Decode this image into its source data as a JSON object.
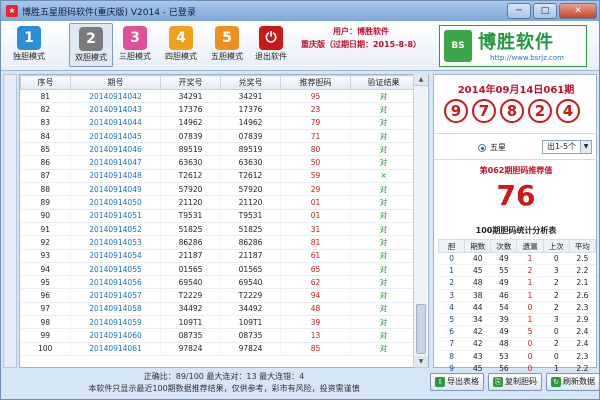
{
  "window": {
    "title": "博胜五星胆码软件(重庆版) V2014 - 已登录",
    "minimize": "─",
    "maximize": "□",
    "close": "✕"
  },
  "toolbar": [
    {
      "num": "1",
      "label": "独胆模式",
      "color": "#2b8fd8"
    },
    {
      "num": "2",
      "label": "双胆模式",
      "color": "#7a7a7a"
    },
    {
      "num": "3",
      "label": "三胆模式",
      "color": "#e0509a"
    },
    {
      "num": "4",
      "label": "四胆模式",
      "color": "#f0a020"
    },
    {
      "num": "5",
      "label": "五胆模式",
      "color": "#f09020"
    },
    {
      "num": "⏻",
      "label": "退出软件",
      "color": "#c81818"
    }
  ],
  "user": {
    "line1": "用户：博胜软件",
    "line2": "重庆版（过期日期：2015-8-8）"
  },
  "logo": {
    "mark": "BS",
    "name": "博胜软件",
    "url": "http://www.bsrjz.com"
  },
  "grid": {
    "headers": [
      "序号",
      "期号",
      "开奖号",
      "兑奖号",
      "推荐胆码",
      "验证结果"
    ],
    "rows": [
      [
        "81",
        "20140914042",
        "34291",
        "34291",
        "95",
        "对"
      ],
      [
        "82",
        "20140914043",
        "17376",
        "17376",
        "23",
        "对"
      ],
      [
        "83",
        "20140914044",
        "14962",
        "14962",
        "79",
        "对"
      ],
      [
        "84",
        "20140914045",
        "07839",
        "07839",
        "71",
        "对"
      ],
      [
        "85",
        "20140914046",
        "89519",
        "89519",
        "80",
        "对"
      ],
      [
        "86",
        "20140914047",
        "63630",
        "63630",
        "50",
        "对"
      ],
      [
        "87",
        "20140914048",
        "T2612",
        "T2612",
        "59",
        "×"
      ],
      [
        "88",
        "20140914049",
        "57920",
        "57920",
        "29",
        "对"
      ],
      [
        "89",
        "20140914050",
        "21120",
        "21120",
        "01",
        "对"
      ],
      [
        "90",
        "20140914051",
        "T9531",
        "T9531",
        "01",
        "对"
      ],
      [
        "91",
        "20140914052",
        "51825",
        "51825",
        "31",
        "对"
      ],
      [
        "92",
        "20140914053",
        "86286",
        "86286",
        "81",
        "对"
      ],
      [
        "93",
        "20140914054",
        "21187",
        "21187",
        "61",
        "对"
      ],
      [
        "94",
        "20140914055",
        "01565",
        "01565",
        "65",
        "对"
      ],
      [
        "95",
        "20140914056",
        "69540",
        "69540",
        "62",
        "对"
      ],
      [
        "96",
        "20140914057",
        "T2229",
        "T2229",
        "94",
        "对"
      ],
      [
        "97",
        "20140914058",
        "34492",
        "34492",
        "48",
        "对"
      ],
      [
        "98",
        "20140914059",
        "109T1",
        "109T1",
        "39",
        "对"
      ],
      [
        "99",
        "20140914060",
        "08735",
        "08735",
        "13",
        "对"
      ],
      [
        "100",
        "20140914061",
        "97824",
        "97824",
        "85",
        "对"
      ]
    ]
  },
  "status": {
    "line1": "正确比：89/100  最大连对：13  最大连错：4",
    "line2": "本软件只显示最近100期数据推荐结果，仅供参考，彩市有风险，投资需谨慎"
  },
  "current": {
    "title": "2014年09月14日061期",
    "balls": [
      "9",
      "7",
      "8",
      "2",
      "4"
    ]
  },
  "mode": {
    "radio_label": "五星",
    "select_value": "出1-5个",
    "dd": "▼"
  },
  "recommend": {
    "title": "第062期胆码推荐值",
    "value": "76"
  },
  "stats": {
    "title": "100期胆码统计分析表",
    "headers": [
      "胆",
      "期数",
      "次数",
      "遗漏",
      "上次",
      "平均"
    ],
    "rows": [
      [
        "0",
        "40",
        "49",
        "1",
        "0",
        "2.5"
      ],
      [
        "1",
        "45",
        "55",
        "2",
        "3",
        "2.2"
      ],
      [
        "2",
        "48",
        "49",
        "1",
        "2",
        "2.1"
      ],
      [
        "3",
        "38",
        "46",
        "1",
        "2",
        "2.6"
      ],
      [
        "4",
        "44",
        "54",
        "0",
        "2",
        "2.3"
      ],
      [
        "5",
        "34",
        "39",
        "1",
        "3",
        "2.9"
      ],
      [
        "6",
        "42",
        "49",
        "5",
        "0",
        "2.4"
      ],
      [
        "7",
        "42",
        "48",
        "0",
        "2",
        "2.4"
      ],
      [
        "8",
        "43",
        "53",
        "0",
        "0",
        "2.3"
      ],
      [
        "9",
        "45",
        "56",
        "0",
        "1",
        "2.2"
      ]
    ]
  },
  "buttons": [
    {
      "label": "导出表格",
      "color": "#2a9a3a"
    },
    {
      "label": "复制胆码",
      "color": "#2a9a3a"
    },
    {
      "label": "刷新数据",
      "color": "#2a9a3a"
    }
  ]
}
